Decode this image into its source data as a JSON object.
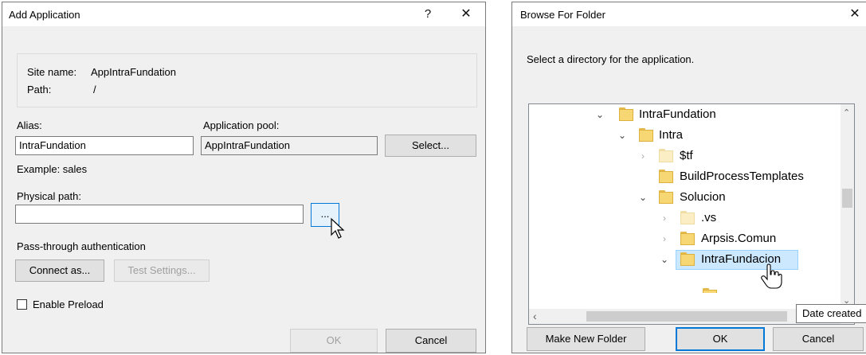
{
  "add_dialog": {
    "title": "Add Application",
    "help_glyph": "?",
    "close_glyph": "✕",
    "site_name_label": "Site name:",
    "site_name_value": "AppIntraFundation",
    "path_label": "Path:",
    "path_value": "/",
    "alias_label": "Alias:",
    "alias_value": "IntraFundation",
    "example_text": "Example: sales",
    "app_pool_label": "Application pool:",
    "app_pool_value": "AppIntraFundation",
    "select_label": "Select...",
    "physical_path_label": "Physical path:",
    "physical_path_value": "",
    "browse_label": "...",
    "pass_through_label": "Pass-through authentication",
    "connect_as_label": "Connect as...",
    "test_settings_label": "Test Settings...",
    "enable_preload_label": "Enable Preload",
    "ok_label": "OK",
    "cancel_label": "Cancel"
  },
  "browse_dialog": {
    "title": "Browse For Folder",
    "close_glyph": "✕",
    "instruction": "Select a directory for the application.",
    "tree": [
      {
        "label": "IntraFundation",
        "expander": "expanded"
      },
      {
        "label": "Intra",
        "expander": "expanded"
      },
      {
        "label": "$tf",
        "expander": "collapsed"
      },
      {
        "label": "BuildProcessTemplates",
        "expander": "none"
      },
      {
        "label": "Solucion",
        "expander": "expanded"
      },
      {
        "label": ".vs",
        "expander": "collapsed"
      },
      {
        "label": "Arpsis.Comun",
        "expander": "collapsed"
      },
      {
        "label": "IntraFundacion",
        "expander": "expanded",
        "selected": true
      }
    ],
    "tooltip": "Date created",
    "make_new_folder_label": "Make New Folder",
    "ok_label": "OK",
    "cancel_label": "Cancel"
  },
  "colors": {
    "dialog_bg": "#f0f0f0",
    "accent": "#0078d7",
    "selection": "#cce8ff",
    "folder": "#f7d774"
  }
}
